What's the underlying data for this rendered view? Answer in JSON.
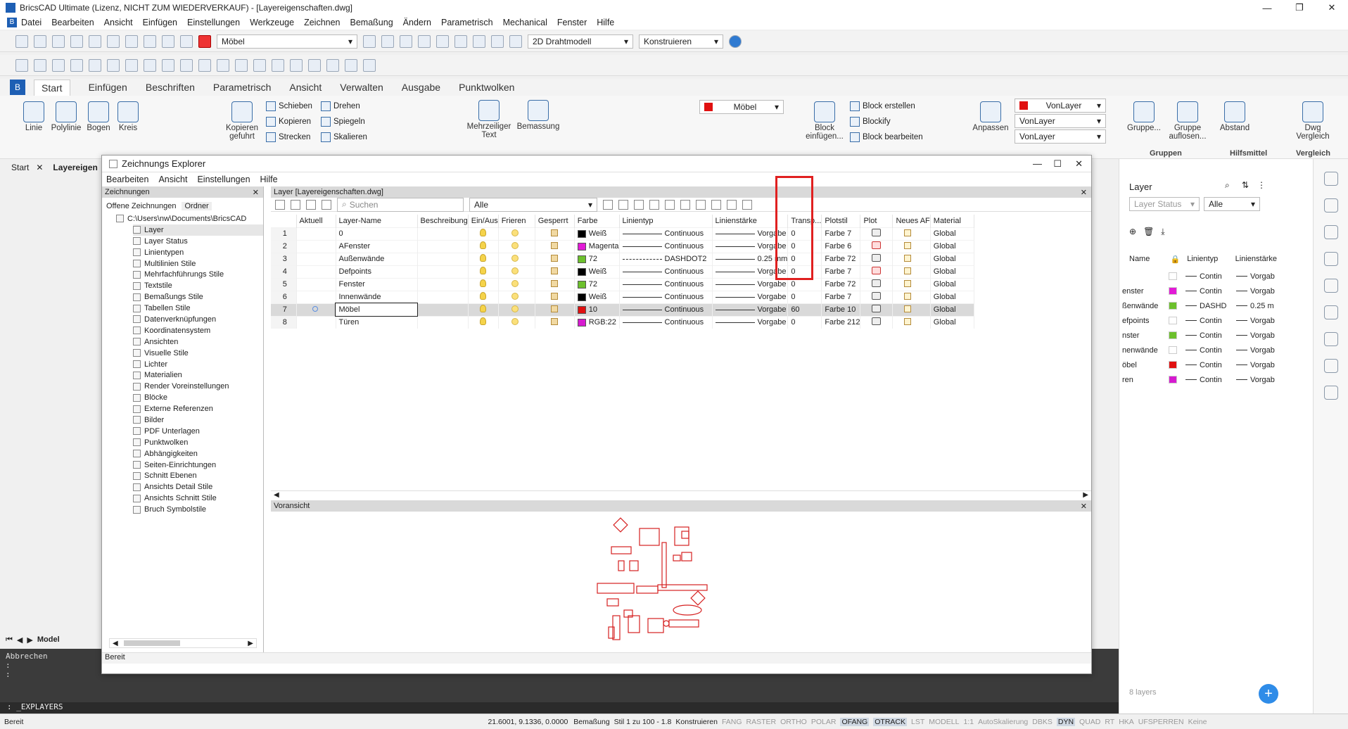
{
  "window": {
    "title": "BricsCAD Ultimate (Lizenz, NICHT ZUM WIEDERVERKAUF) - [Layereigenschaften.dwg]"
  },
  "menubar": [
    "Datei",
    "Bearbeiten",
    "Ansicht",
    "Einfügen",
    "Einstellungen",
    "Werkzeuge",
    "Zeichnen",
    "Bemaßung",
    "Ändern",
    "Parametrisch",
    "Mechanical",
    "Fenster",
    "Hilfe"
  ],
  "toolbar": {
    "layer_select": "Möbel",
    "visual_style": "2D Drahtmodell",
    "workspace": "Konstruieren"
  },
  "ribbon_tabs": [
    "Start",
    "Einfügen",
    "Beschriften",
    "Parametrisch",
    "Ansicht",
    "Verwalten",
    "Ausgabe",
    "Punktwolken"
  ],
  "ribbon": {
    "draw": [
      "Linie",
      "Polylinie",
      "Bogen",
      "Kreis"
    ],
    "modify": [
      "Kopieren gefuhrt",
      "Schieben",
      "Kopieren",
      "Strecken",
      "Drehen",
      "Spiegeln",
      "Skalieren"
    ],
    "annot": [
      "Mehrzeiliger Text",
      "Bemassung"
    ],
    "layer_name": "Möbel",
    "block": [
      "Block einfügen...",
      "Block erstellen",
      "Blockify",
      "Block bearbeiten"
    ],
    "props": {
      "adapt": "Anpassen",
      "vonlayer1": "VonLayer",
      "vonlayer2": "VonLayer",
      "vonlayer3": "VonLayer"
    },
    "groups": [
      "Gruppe...",
      "Gruppe auflosen..."
    ],
    "groups_label": "Gruppen",
    "tools_label": "Hilfsmittel",
    "tools": [
      "Abstand"
    ],
    "compare": "Dwg Vergleich",
    "compare_label": "Vergleich"
  },
  "doctabs": {
    "start": "Start",
    "file": "Layereigen"
  },
  "explorer": {
    "title": "Zeichnungs Explorer",
    "menu": [
      "Bearbeiten",
      "Ansicht",
      "Einstellungen",
      "Hilfe"
    ],
    "left_header": "Zeichnungen",
    "left_tabs": [
      "Offene Zeichnungen",
      "Ordner"
    ],
    "tree_root": "C:\\Users\\nw\\Documents\\BricsCAD",
    "tree": [
      "Layer",
      "Layer Status",
      "Linientypen",
      "Multilinien Stile",
      "Mehrfachführungs Stile",
      "Textstile",
      "Bemaßungs Stile",
      "Tabellen Stile",
      "Datenverknüpfungen",
      "Koordinatensystem",
      "Ansichten",
      "Visuelle Stile",
      "Lichter",
      "Materialien",
      "Render Voreinstellungen",
      "Blöcke",
      "Externe Referenzen",
      "Bilder",
      "PDF Unterlagen",
      "Punktwolken",
      "Abhängigkeiten",
      "Seiten-Einrichtungen",
      "Schnitt Ebenen",
      "Ansichts Detail Stile",
      "Ansichts Schnitt Stile",
      "Bruch Symbolstile"
    ],
    "layer_header": "Layer [Layereigenschaften.dwg]",
    "search_placeholder": "Suchen",
    "filter": "Alle",
    "columns": [
      "",
      "Aktuell",
      "Layer-Name",
      "Beschreibung",
      "Ein/Aus",
      "Frieren",
      "Gesperrt",
      "Farbe",
      "Linientyp",
      "Linienstärke",
      "Transp...",
      "Plotstil",
      "Plot",
      "Neues AF",
      "Material"
    ],
    "rows": [
      {
        "n": "1",
        "name": "0",
        "color": "Weiß",
        "hex": "#000000",
        "lt": "Continuous",
        "lw": "Vorgabe",
        "tr": "0",
        "ps": "Farbe 7",
        "plot": "yes",
        "mat": "Global"
      },
      {
        "n": "2",
        "name": "AFenster",
        "color": "Magenta",
        "hex": "#e21ad6",
        "lt": "Continuous",
        "lw": "Vorgabe",
        "tr": "0",
        "ps": "Farbe 6",
        "plot": "no",
        "mat": "Global"
      },
      {
        "n": "3",
        "name": "Außenwände",
        "color": "72",
        "hex": "#6cc02c",
        "lt": "DASHDOT2",
        "lw": "0.25 mm",
        "tr": "0",
        "ps": "Farbe 72",
        "plot": "yes",
        "mat": "Global"
      },
      {
        "n": "4",
        "name": "Defpoints",
        "color": "Weiß",
        "hex": "#000000",
        "lt": "Continuous",
        "lw": "Vorgabe",
        "tr": "0",
        "ps": "Farbe 7",
        "plot": "no",
        "mat": "Global"
      },
      {
        "n": "5",
        "name": "Fenster",
        "color": "72",
        "hex": "#6cc02c",
        "lt": "Continuous",
        "lw": "Vorgabe",
        "tr": "0",
        "ps": "Farbe 72",
        "plot": "yes",
        "mat": "Global"
      },
      {
        "n": "6",
        "name": "Innenwände",
        "color": "Weiß",
        "hex": "#000000",
        "lt": "Continuous",
        "lw": "Vorgabe",
        "tr": "0",
        "ps": "Farbe 7",
        "plot": "yes",
        "mat": "Global"
      },
      {
        "n": "7",
        "name": "Möbel",
        "color": "10",
        "hex": "#e01010",
        "lt": "Continuous",
        "lw": "Vorgabe",
        "tr": "60",
        "ps": "Farbe 10",
        "plot": "yes",
        "mat": "Global"
      },
      {
        "n": "8",
        "name": "Türen",
        "color": "RGB:22",
        "hex": "#d61ad0",
        "lt": "Continuous",
        "lw": "Vorgabe",
        "tr": "0",
        "ps": "Farbe 212",
        "plot": "yes",
        "mat": "Global"
      }
    ],
    "preview_header": "Voransicht",
    "status": "Bereit"
  },
  "right_panel": {
    "title": "Layer",
    "status_sel": "Layer Status",
    "filter": "Alle",
    "columns": [
      "Name",
      "",
      "Linientyp",
      "Linienstärke"
    ],
    "rows": [
      {
        "name": "",
        "hex": "#ffffff",
        "lt": "Contin",
        "lw": "Vorgab"
      },
      {
        "name": "enster",
        "hex": "#e21ad6",
        "lt": "Contin",
        "lw": "Vorgab"
      },
      {
        "name": "ßenwände",
        "hex": "#6cc02c",
        "lt": "DASHD",
        "lw": "0.25 m"
      },
      {
        "name": "efpoints",
        "hex": "#ffffff",
        "lt": "Contin",
        "lw": "Vorgab"
      },
      {
        "name": "nster",
        "hex": "#6cc02c",
        "lt": "Contin",
        "lw": "Vorgab"
      },
      {
        "name": "nenwände",
        "hex": "#ffffff",
        "lt": "Contin",
        "lw": "Vorgab"
      },
      {
        "name": "öbel",
        "hex": "#e01010",
        "lt": "Contin",
        "lw": "Vorgab"
      },
      {
        "name": "ren",
        "hex": "#d61ad0",
        "lt": "Contin",
        "lw": "Vorgab"
      }
    ],
    "count": "8 layers"
  },
  "command": {
    "history1": "Abbrechen",
    "history2": ":",
    "history3": ":",
    "input": ": _EXPLAYERS"
  },
  "model_tab": "Model",
  "statusbar": {
    "left": "Bereit",
    "coords": "21.6001, 9.1336, 0.0000",
    "items": [
      "Bemaßung",
      "Stil 1 zu 100 - 1.8",
      "Konstruieren",
      "FANG",
      "RASTER",
      "ORTHO",
      "POLAR",
      "OFANG",
      "OTRACK",
      "LST",
      "MODELL",
      "1:1",
      "AutoSkalierung",
      "DBKS",
      "DYN",
      "QUAD",
      "RT",
      "HKA",
      "UFSPERREN",
      "Keine"
    ]
  }
}
